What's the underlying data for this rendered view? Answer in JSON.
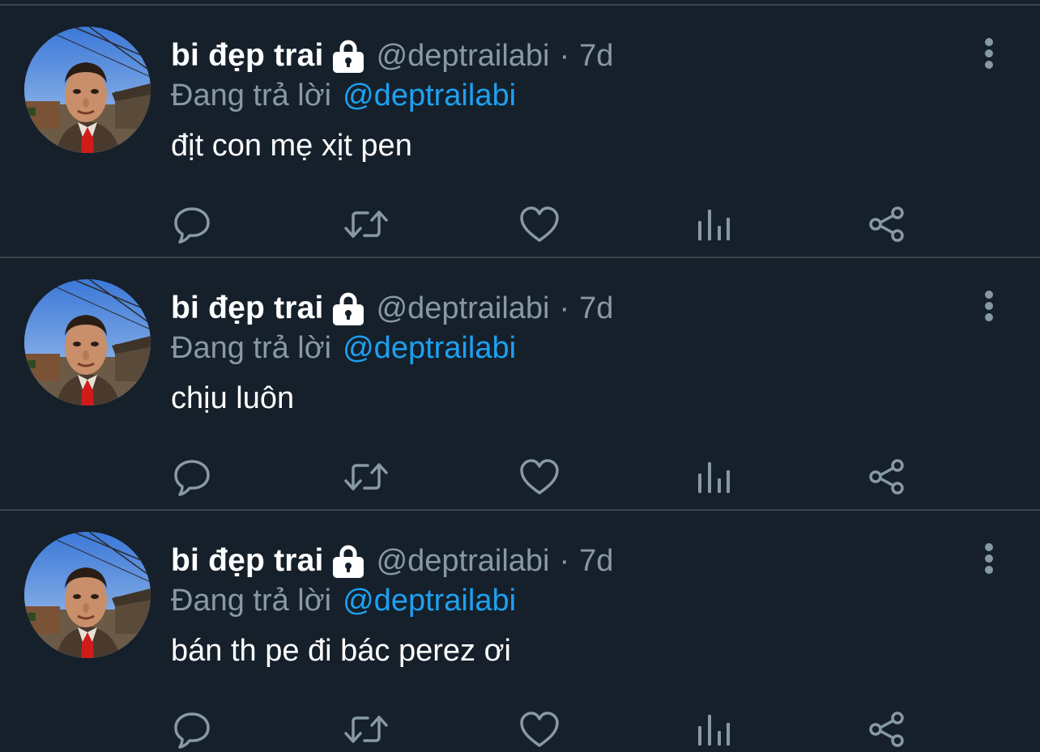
{
  "colors": {
    "background": "#15202b",
    "divider": "#38444d",
    "secondary_text": "#8899a6",
    "link": "#1da1f2",
    "primary_text": "#ffffff"
  },
  "tweets": [
    {
      "display_name": "bi đẹp trai",
      "handle": "@deptrailabi",
      "separator": "·",
      "time": "7d",
      "reply_label": "Đang trả lời",
      "reply_to": "@deptrailabi",
      "text": "địt con mẹ xịt pen",
      "icons": [
        "lock-icon",
        "more-vertical-icon",
        "reply-icon",
        "retweet-icon",
        "like-icon",
        "analytics-icon",
        "share-icon"
      ]
    },
    {
      "display_name": "bi đẹp trai",
      "handle": "@deptrailabi",
      "separator": "·",
      "time": "7d",
      "reply_label": "Đang trả lời",
      "reply_to": "@deptrailabi",
      "text": "chịu luôn",
      "icons": [
        "lock-icon",
        "more-vertical-icon",
        "reply-icon",
        "retweet-icon",
        "like-icon",
        "analytics-icon",
        "share-icon"
      ]
    },
    {
      "display_name": "bi đẹp trai",
      "handle": "@deptrailabi",
      "separator": "·",
      "time": "7d",
      "reply_label": "Đang trả lời",
      "reply_to": "@deptrailabi",
      "text": "bán th pe đi bác perez ơi",
      "icons": [
        "lock-icon",
        "more-vertical-icon",
        "reply-icon",
        "retweet-icon",
        "like-icon",
        "analytics-icon",
        "share-icon"
      ]
    }
  ]
}
